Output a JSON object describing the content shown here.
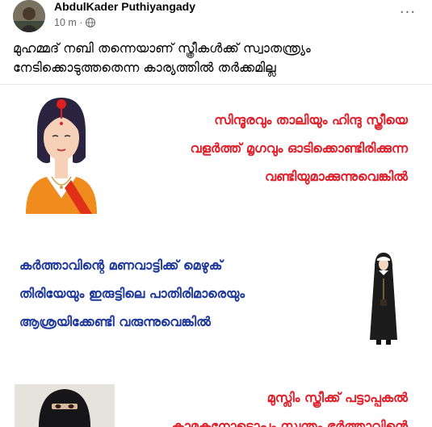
{
  "post": {
    "author": "AbdulKader Puthiyangady",
    "time": "10 m ·",
    "privacy_icon": "globe-icon",
    "more_icon": "more-horizontal-icon",
    "more_label": "···",
    "caption": "മുഹമ്മദ് നബി തന്നെയാണ് സ്ത്രീകൾക്ക് സ്വാതന്ത്ര്യം നേടിക്കൊടുത്തതെന്ന കാര്യത്തിൽ തർക്കമില്ല"
  },
  "image": {
    "block1": [
      "സിന്ദൂരവും താലിയും ഹിന്ദു സ്ത്രീയെ",
      "വളർത്ത് മൃഗവും ഓടിക്കൊണ്ടിരിക്കുന്ന",
      "വണ്ടിയുമാക്കുന്നുവെങ്കിൽ"
    ],
    "block2": [
      "കർത്താവിന്റെ മണവാട്ടിക്ക് മെഴുക്",
      "തിരിയേയും ഇരുട്ടിലെ പാതിരിമാരെയും",
      "ആശ്രയിക്കേണ്ടി വരുന്നുവെങ്കിൽ"
    ],
    "block3": [
      "മുസ്ലിം സ്ത്രീക്ക് പട്ടാപ്പകൽ",
      "കാമുകനോടൊപ്പം സ്വന്തം ഭർത്താവിന്റെ"
    ],
    "colors": {
      "red_text": "#e0202a",
      "blue_text": "#1f3a9c"
    }
  }
}
